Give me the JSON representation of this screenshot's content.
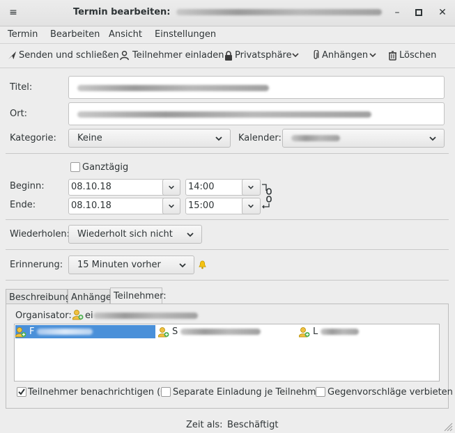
{
  "window": {
    "title": "Termin bearbeiten:"
  },
  "menu": [
    {
      "label": "Termin"
    },
    {
      "label": "Bearbeiten"
    },
    {
      "label": "Ansicht"
    },
    {
      "label": "Einstellungen"
    }
  ],
  "toolbar": {
    "send": "Senden und schließen",
    "invite": "Teilnehmer einladen",
    "privacy": "Privatsphäre",
    "attach": "Anhängen",
    "delete": "Löschen"
  },
  "form": {
    "title_label": "Titel:",
    "location_label": "Ort:",
    "category_label": "Kategorie:",
    "category_value": "Keine",
    "calendar_label": "Kalender:",
    "allday_label": "Ganztägig",
    "allday_checked": false,
    "start_label": "Beginn:",
    "start_date": "08.10.18",
    "start_time": "14:00",
    "end_label": "Ende:",
    "end_date": "08.10.18",
    "end_time": "15:00",
    "repeat_label": "Wiederholen:",
    "repeat_value": "Wiederholt sich nicht",
    "reminder_label": "Erinnerung:",
    "reminder_value": "15 Minuten vorher"
  },
  "tabs": [
    {
      "label": "Beschreibung:",
      "active": false
    },
    {
      "label": "Anhänge:",
      "active": false
    },
    {
      "label": "Teilnehmer:",
      "active": true
    }
  ],
  "attendees": {
    "organizer_label": "Organisator:",
    "organizer_initial": "ei",
    "items": [
      {
        "initial": "F",
        "selected": true
      },
      {
        "initial": "S",
        "selected": false
      },
      {
        "initial": "L",
        "selected": false
      }
    ],
    "notify_label": "Teilnehmer benachrichtigen (Q)",
    "notify_checked": true,
    "separate_label": "Separate Einladung je Teilnehmer",
    "separate_checked": false,
    "nocounter_label": "Gegenvorschläge verbieten",
    "nocounter_checked": false
  },
  "status": {
    "label": "Zeit als:",
    "value": "Beschäftigt"
  }
}
